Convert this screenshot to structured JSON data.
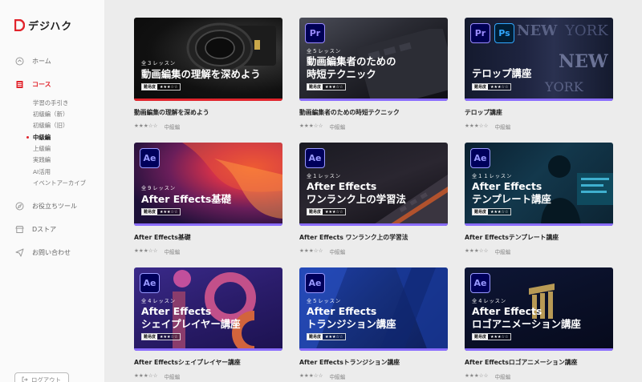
{
  "brand": {
    "name": "デジハク",
    "accent": "#e1242c"
  },
  "nav": [
    {
      "label": "ホーム",
      "icon": "home-icon"
    },
    {
      "label": "コース",
      "icon": "course-icon"
    },
    {
      "label": "お役立ちツール",
      "icon": "compass-icon"
    },
    {
      "label": "Dストア",
      "icon": "store-icon"
    },
    {
      "label": "お問い合わせ",
      "icon": "send-icon"
    }
  ],
  "course_submenu": [
    {
      "label": "学習の手引き"
    },
    {
      "label": "初級編（新）"
    },
    {
      "label": "初級編（旧）"
    },
    {
      "label": "中級編"
    },
    {
      "label": "上級編"
    },
    {
      "label": "実践編"
    },
    {
      "label": "AI活用"
    },
    {
      "label": "イベントアーカイブ"
    }
  ],
  "logout": "ログアウト",
  "difficulty_label": "難易度",
  "cards": [
    {
      "badges": [],
      "lessons": "全３レッスン",
      "thumb_title": [
        "動画編集の理解を深めよう"
      ],
      "stars": "★★★☆☆",
      "title": "動画編集の理解を深めよう",
      "rating": "★★★☆☆",
      "level": "中級編"
    },
    {
      "badges": [
        "Pr"
      ],
      "lessons": "全５レッスン",
      "thumb_title": [
        "動画編集者のための",
        "時短テクニック"
      ],
      "stars": "★★★☆☆",
      "title": "動画編集者のための時短テクニック",
      "rating": "★★★☆☆",
      "level": "中級編"
    },
    {
      "badges": [
        "Pr",
        "Ps"
      ],
      "lessons": "",
      "thumb_title": [
        "テロップ講座"
      ],
      "stars": "★★★☆☆",
      "title": "テロップ講座",
      "rating": "★★★☆☆",
      "level": "中級編"
    },
    {
      "badges": [
        "Ae"
      ],
      "lessons": "全９レッスン",
      "thumb_title": [
        "After Effects基礎"
      ],
      "stars": "★★★☆☆",
      "title": "After Effects基礎",
      "rating": "★★★☆☆",
      "level": "中級編"
    },
    {
      "badges": [
        "Ae"
      ],
      "lessons": "全１レッスン",
      "thumb_title": [
        "After Effects",
        "ワンランク上の学習法"
      ],
      "stars": "★★★☆☆",
      "title": "After Effects ワンランク上の学習法",
      "rating": "★★★☆☆",
      "level": "中級編"
    },
    {
      "badges": [
        "Ae"
      ],
      "lessons": "全１１レッスン",
      "thumb_title": [
        "After Effects",
        "テンプレート講座"
      ],
      "stars": "★★★☆☆",
      "title": "After Effectsテンプレート講座",
      "rating": "★★★☆☆",
      "level": "中級編"
    },
    {
      "badges": [
        "Ae"
      ],
      "lessons": "全４レッスン",
      "thumb_title": [
        "After Effects",
        "シェイプレイヤー講座"
      ],
      "stars": "★★★☆☆",
      "title": "After Effectsシェイプレイヤー講座",
      "rating": "★★★☆☆",
      "level": "中級編"
    },
    {
      "badges": [
        "Ae"
      ],
      "lessons": "全５レッスン",
      "thumb_title": [
        "After Effects",
        "トランジション講座"
      ],
      "stars": "★★★☆☆",
      "title": "After Effectsトランジション講座",
      "rating": "★★★☆☆",
      "level": "中級編"
    },
    {
      "badges": [
        "Ae"
      ],
      "lessons": "全４レッスン",
      "thumb_title": [
        "After Effects",
        "ロゴアニメーション講座"
      ],
      "stars": "★★★☆☆",
      "title": "After Effectsロゴアニメーション講座",
      "rating": "★★★☆☆",
      "level": "中級編"
    }
  ]
}
